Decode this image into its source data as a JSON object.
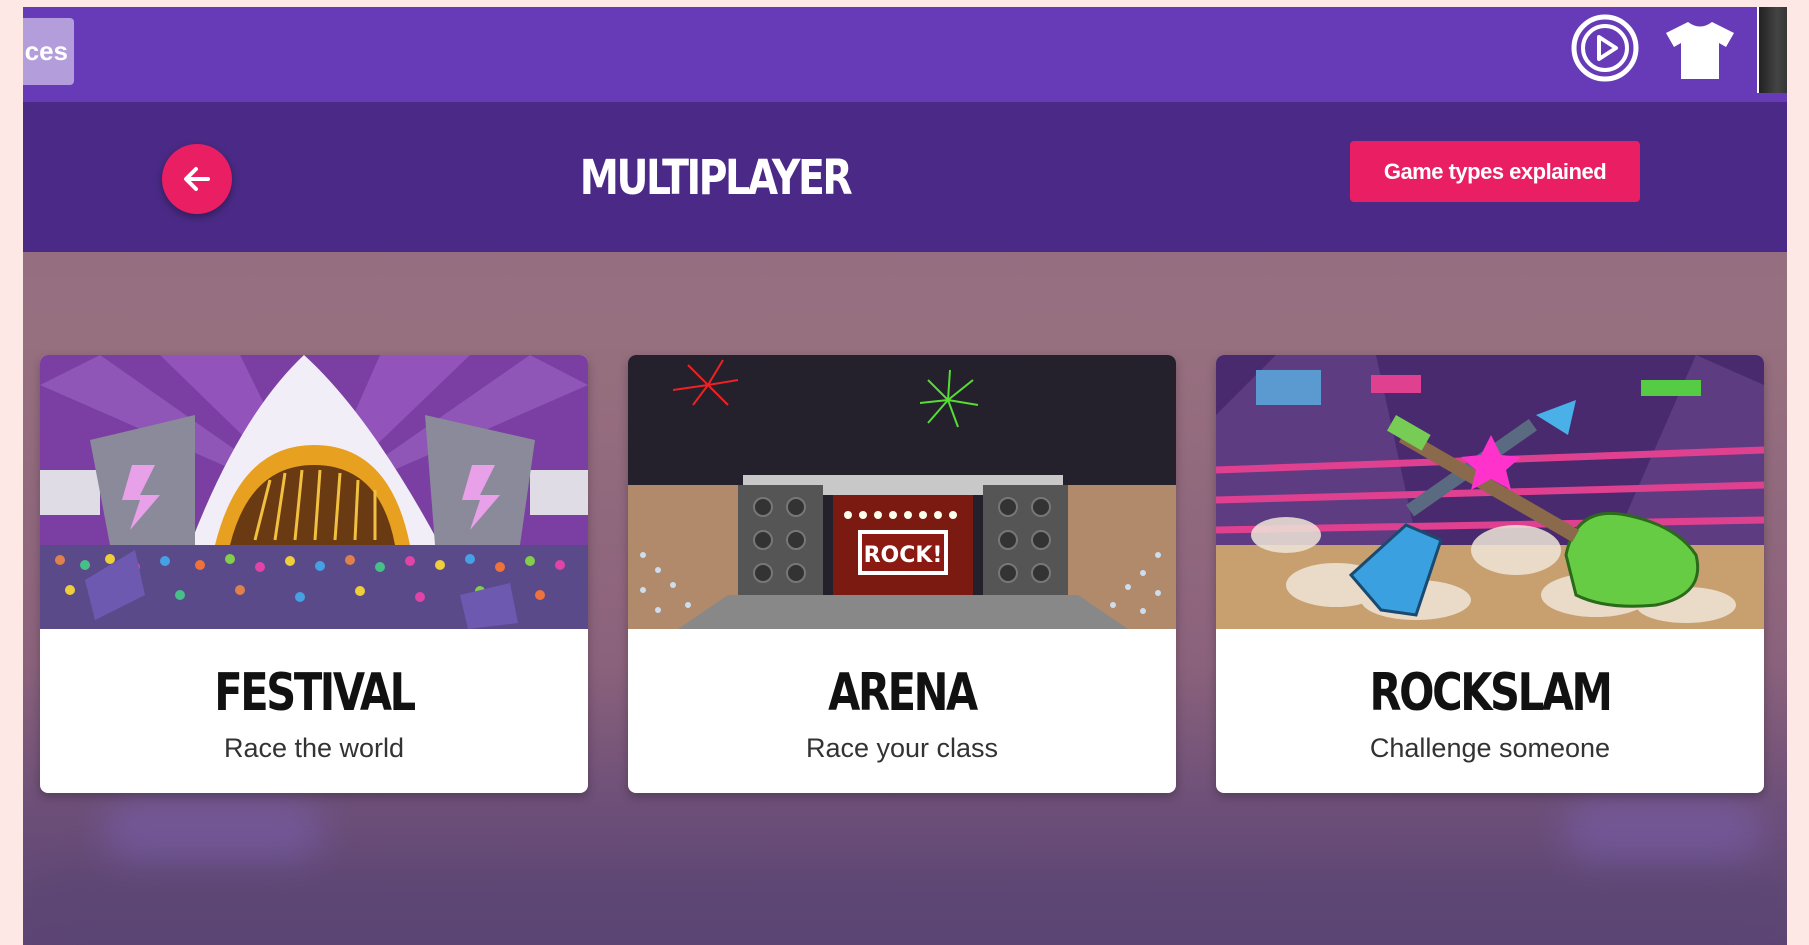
{
  "topbar": {
    "resources_tab_label": "ces",
    "icons": [
      "play-circle-icon",
      "tshirt-icon"
    ]
  },
  "header": {
    "title": "MULTIPLAYER",
    "explain_button_label": "Game types explained",
    "back_icon": "arrow-left-icon"
  },
  "cards": [
    {
      "title": "FESTIVAL",
      "subtitle": "Race the world"
    },
    {
      "title": "ARENA",
      "subtitle": "Race your class",
      "stage_sign": "ROCK!"
    },
    {
      "title": "ROCKSLAM",
      "subtitle": "Challenge someone"
    }
  ],
  "colors": {
    "topbar": "#673ab7",
    "header": "#4a2a86",
    "accent": "#e91e63",
    "page_frame": "#fde8e6"
  }
}
